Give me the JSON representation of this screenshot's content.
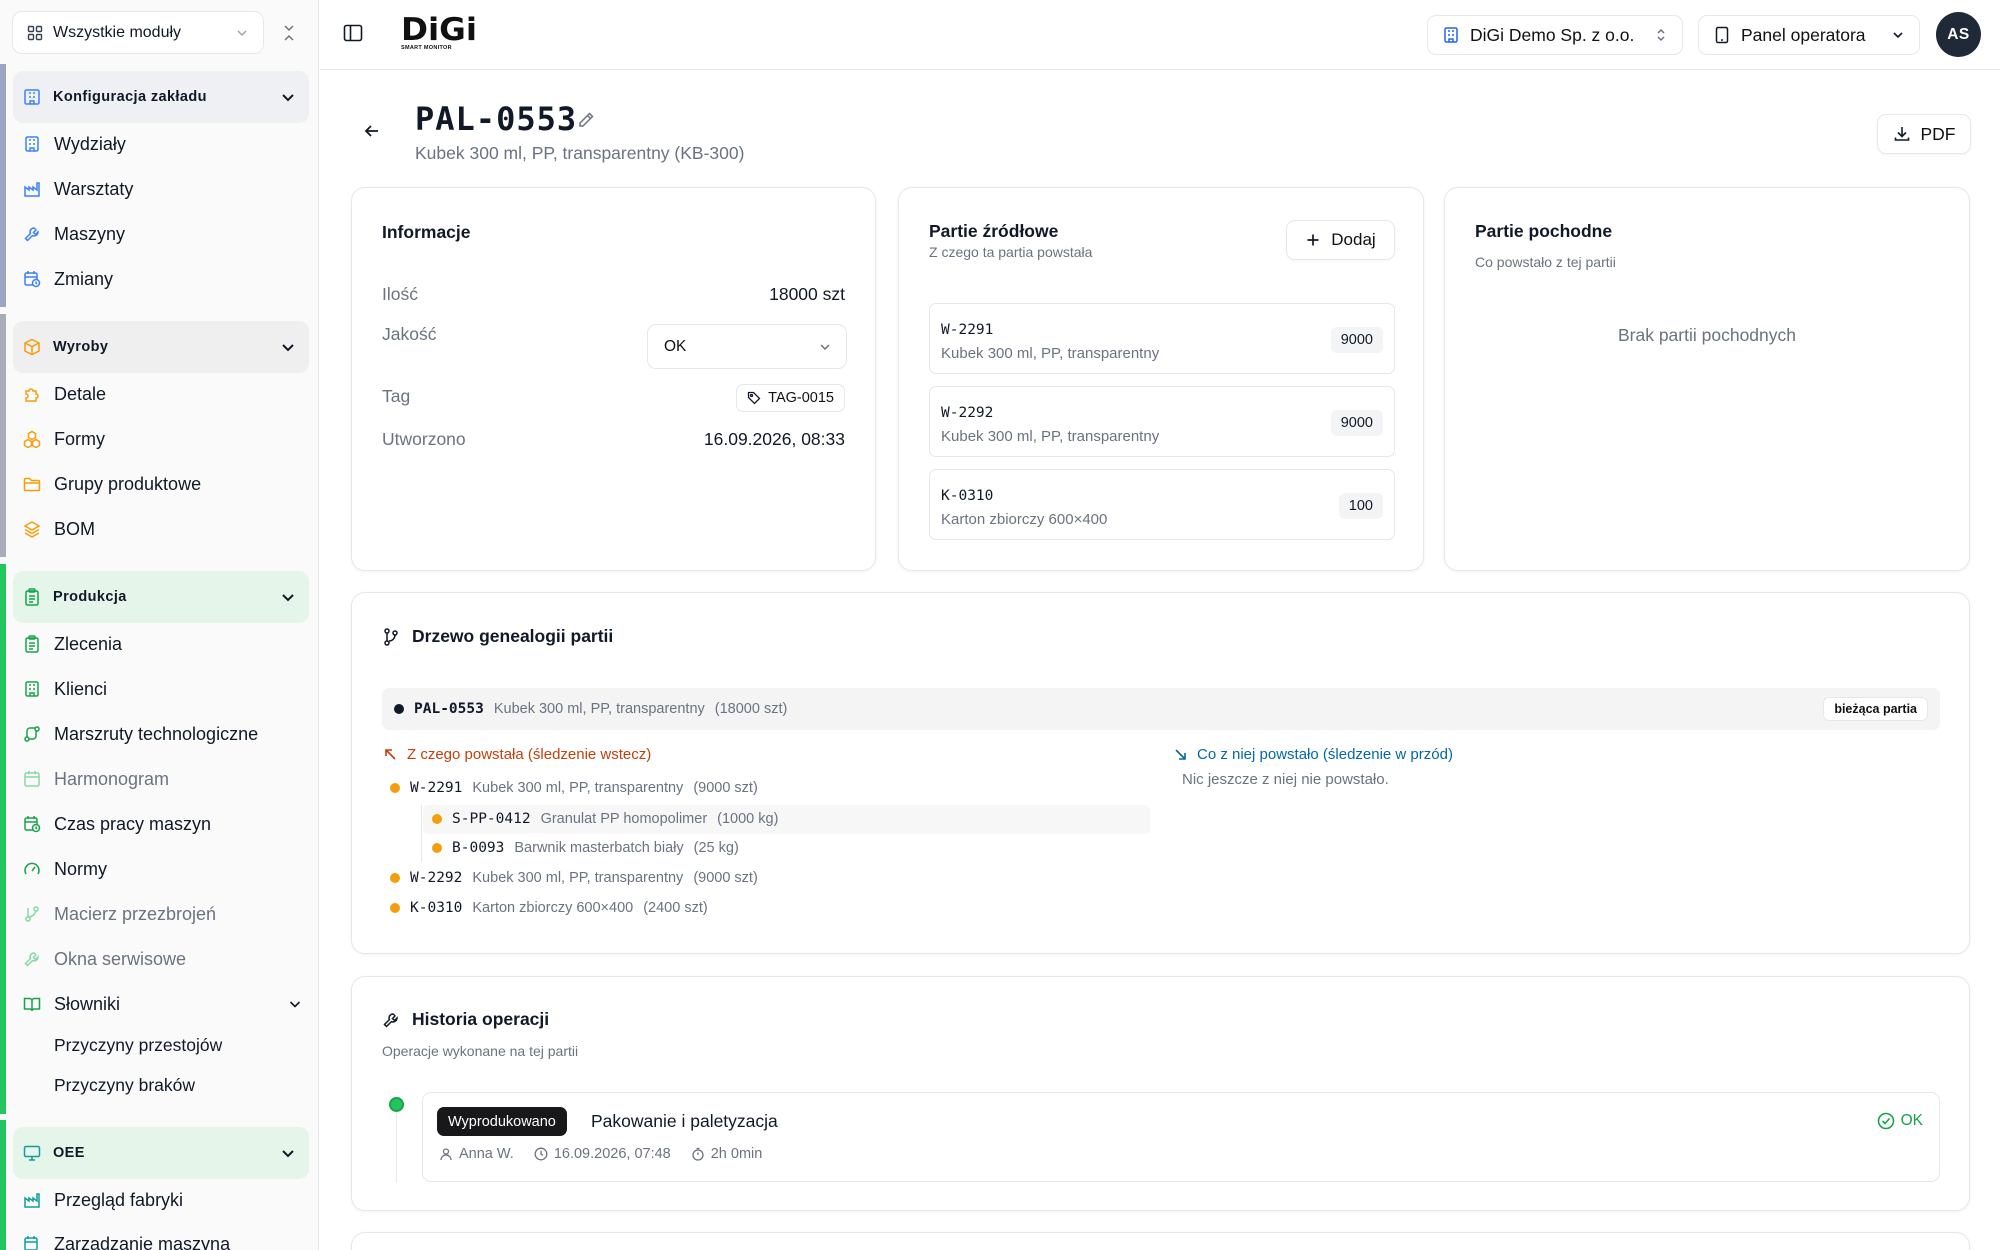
{
  "sidebar": {
    "module_select": "Wszystkie moduły",
    "sections": [
      {
        "title": "Konfiguracja zakładu",
        "accent": "#9aa6c4",
        "items": [
          "Wydziały",
          "Warsztaty",
          "Maszyny",
          "Zmiany"
        ]
      },
      {
        "title": "Wyroby",
        "accent": "#a9adb8",
        "items": [
          "Detale",
          "Formy",
          "Grupy produktowe",
          "BOM"
        ]
      },
      {
        "title": "Produkcja",
        "accent": "#22c55e",
        "items": [
          "Zlecenia",
          "Klienci",
          "Marszruty technologiczne",
          "Harmonogram",
          "Czas pracy maszyn",
          "Normy",
          "Macierz przezbrojeń",
          "Okna serwisowe",
          "Słowniki"
        ],
        "subitems": [
          "Przyczyny przestojów",
          "Przyczyny braków"
        ]
      },
      {
        "title": "OEE",
        "accent": "#22c55e",
        "items": [
          "Przegląd fabryki",
          "Zarządzanie maszyną"
        ]
      }
    ]
  },
  "topbar": {
    "logo_text": "DiGi",
    "logo_subtext": "SMART MONITOR",
    "company": "DiGi Demo Sp. z o.o.",
    "panel": "Panel operatora",
    "avatar_initials": "AS"
  },
  "page": {
    "title": "PAL-0553",
    "subtitle": "Kubek 300 ml, PP, transparentny (KB-300)",
    "pdf_label": "PDF"
  },
  "info": {
    "title": "Informacje",
    "qty_label": "Ilość",
    "qty_value": "18000 szt",
    "quality_label": "Jakość",
    "quality_value": "OK",
    "tag_label": "Tag",
    "tag_value": "TAG-0015",
    "created_label": "Utworzono",
    "created_value": "16.09.2026, 08:33"
  },
  "sources": {
    "title": "Partie źródłowe",
    "subtitle": "Z czego ta partia powstała",
    "add_label": "Dodaj",
    "items": [
      {
        "code": "W-2291",
        "desc": "Kubek 300 ml, PP, transparentny",
        "qty": "9000"
      },
      {
        "code": "W-2292",
        "desc": "Kubek 300 ml, PP, transparentny",
        "qty": "9000"
      },
      {
        "code": "K-0310",
        "desc": "Karton zbiorczy 600×400",
        "qty": "100"
      }
    ]
  },
  "derived": {
    "title": "Partie pochodne",
    "subtitle": "Co powstało z tej partii",
    "empty": "Brak partii pochodnych"
  },
  "genealogy": {
    "title": "Drzewo genealogii partii",
    "current": {
      "code": "PAL-0553",
      "name": "Kubek 300 ml, PP, transparentny",
      "qty": "(18000 szt)",
      "badge": "bieżąca partia"
    },
    "backward_title": "Z czego powstała (śledzenie wstecz)",
    "forward_title": "Co z niej powstało (śledzenie w przód)",
    "forward_empty": "Nic jeszcze z niej nie powstało.",
    "backward": [
      {
        "code": "W-2291",
        "name": "Kubek 300 ml, PP, transparentny",
        "qty": "(9000 szt)"
      },
      {
        "code": "S-PP-0412",
        "name": "Granulat PP homopolimer",
        "qty": "(1000 kg)"
      },
      {
        "code": "B-0093",
        "name": "Barwnik masterbatch biały",
        "qty": "(25 kg)"
      },
      {
        "code": "W-2292",
        "name": "Kubek 300 ml, PP, transparentny",
        "qty": "(9000 szt)"
      },
      {
        "code": "K-0310",
        "name": "Karton zbiorczy 600×400",
        "qty": "(2400 szt)"
      }
    ]
  },
  "history": {
    "title": "Historia operacji",
    "subtitle": "Operacje wykonane na tej partii",
    "items": [
      {
        "badge": "Wyprodukowano",
        "name": "Pakowanie i paletyzacja",
        "status": "OK",
        "user": "Anna W.",
        "time": "16.09.2026, 07:48",
        "duration": "2h 0min"
      }
    ]
  },
  "colors": {
    "accent_orange": "#f59e0b",
    "backward_text": "#c2410c",
    "forward_text": "#0369a1",
    "ok_green": "#16a34a"
  }
}
